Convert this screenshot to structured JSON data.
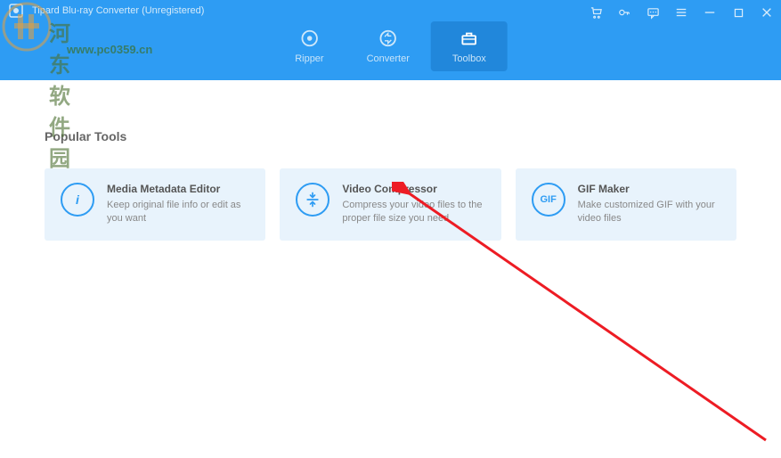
{
  "app": {
    "title": "Tipard Blu-ray Converter (Unregistered)"
  },
  "watermark": {
    "text1": "河东软件园",
    "text2": "www.pc0359.cn"
  },
  "nav": {
    "tabs": [
      {
        "label": "Ripper"
      },
      {
        "label": "Converter"
      },
      {
        "label": "Toolbox"
      }
    ]
  },
  "section": {
    "title": "Popular Tools"
  },
  "tools": [
    {
      "title": "Media Metadata Editor",
      "desc": "Keep original file info or edit as you want",
      "icon_text": "i"
    },
    {
      "title": "Video Compressor",
      "desc": "Compress your video files to the proper file size you need",
      "icon_text": ""
    },
    {
      "title": "GIF Maker",
      "desc": "Make customized GIF with your video files",
      "icon_text": "GIF"
    }
  ]
}
